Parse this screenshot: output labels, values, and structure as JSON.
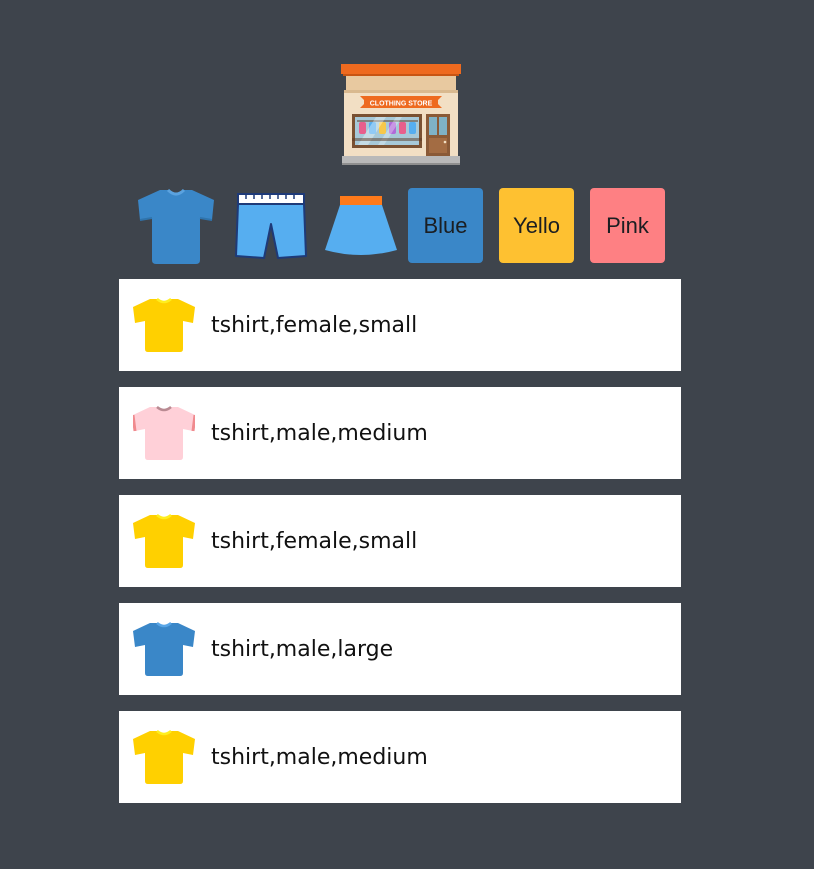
{
  "store": {
    "logo_icon": "clothing-store-icon",
    "sign_text": "CLOTHING STORE"
  },
  "filters": {
    "types": [
      {
        "icon": "tshirt-icon",
        "color": "#3a87c8"
      },
      {
        "icon": "shorts-icon",
        "color": "#56aef0"
      },
      {
        "icon": "skirt-icon",
        "color": "#56aef0"
      }
    ],
    "colors": [
      {
        "label": "Blue",
        "color": "#3a87c8"
      },
      {
        "label": "Yello",
        "color": "#fec131"
      },
      {
        "label": "Pink",
        "color": "#fe8083"
      }
    ]
  },
  "products": [
    {
      "label": "tshirt,female,small",
      "icon": "tshirt-icon",
      "color": "#ffd000"
    },
    {
      "label": "tshirt,male,medium",
      "icon": "tshirt-icon",
      "color": "#ffd0d8"
    },
    {
      "label": "tshirt,female,small",
      "icon": "tshirt-icon",
      "color": "#ffd000"
    },
    {
      "label": "tshirt,male,large",
      "icon": "tshirt-icon",
      "color": "#3a87c8"
    },
    {
      "label": "tshirt,male,medium",
      "icon": "tshirt-icon",
      "color": "#ffd000"
    }
  ]
}
